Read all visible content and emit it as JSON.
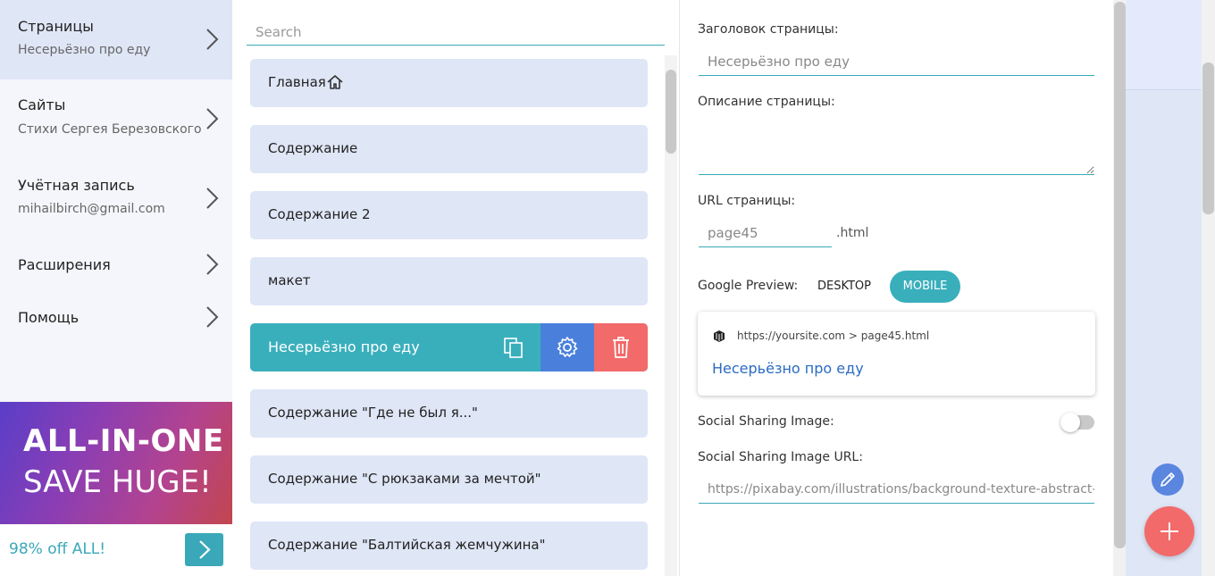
{
  "nav": {
    "items": [
      {
        "title": "Страницы",
        "subtitle": "Несерьёзно про еду"
      },
      {
        "title": "Сайты",
        "subtitle": "Стихи Сергея Березовского"
      },
      {
        "title": "Учётная запись",
        "subtitle": "mihailbirch@gmail.com"
      },
      {
        "title": "Расширения",
        "subtitle": ""
      },
      {
        "title": "Помощь",
        "subtitle": ""
      }
    ],
    "promo": {
      "line1": "ALL-IN-ONE",
      "line2": "SAVE HUGE!",
      "offer": "98% off ALL!"
    }
  },
  "list": {
    "search_placeholder": "Search",
    "pages": [
      {
        "label": "Главная"
      },
      {
        "label": "Содержание"
      },
      {
        "label": "Содержание 2"
      },
      {
        "label": "макет"
      },
      {
        "label": "Несерьёзно про еду"
      },
      {
        "label": "Содержание \"Где не был я...\""
      },
      {
        "label": "Содержание \"С рюкзаками за мечтой\""
      },
      {
        "label": "Содержание \"Балтийская жемчужина\""
      }
    ]
  },
  "panel": {
    "title_label": "Заголовок страницы:",
    "title_value": "Несерьёзно про еду",
    "desc_label": "Описание страницы:",
    "url_label": "URL страницы:",
    "url_value": "page45",
    "url_suffix": ".html",
    "preview_label": "Google Preview:",
    "tab_desktop": "DESKTOP",
    "tab_mobile": "MOBILE",
    "preview_url": "https://yoursite.com > page45.html",
    "preview_title": "Несерьёзно про еду",
    "social_image_label": "Social Sharing Image:",
    "social_image_enabled": false,
    "social_url_label": "Social Sharing Image URL:",
    "social_url_value": "https://pixabay.com/illustrations/background-texture-abstract-ar"
  },
  "colors": {
    "accent": "#3aafbc",
    "blue": "#4a80dc",
    "danger": "#f26a6a",
    "item_bg": "#dfe6f6"
  }
}
